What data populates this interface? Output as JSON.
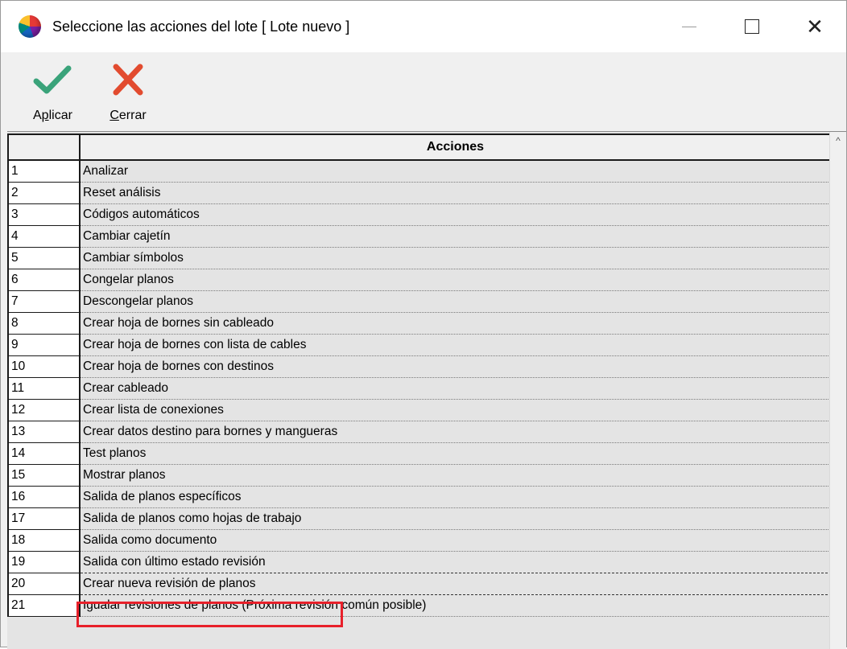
{
  "window": {
    "title": "Seleccione las acciones del lote [ Lote nuevo ]",
    "controls": {
      "minimize": "—",
      "maximize": "☐",
      "close": "✕"
    }
  },
  "toolbar": {
    "apply": {
      "label_pre": "A",
      "label_underlined": "p",
      "label_post": "licar",
      "icon": "check-icon",
      "color": "#3aa37a"
    },
    "close": {
      "label_pre": "",
      "label_underlined": "C",
      "label_post": "errar",
      "icon": "close-x-icon",
      "color": "#e24b2f"
    }
  },
  "grid": {
    "header": {
      "corner": "",
      "actions": "Acciones"
    },
    "selected_row": 20,
    "highlight_color": "#e8202a",
    "rows": [
      {
        "num": "1",
        "action": "Analizar"
      },
      {
        "num": "2",
        "action": "Reset análisis"
      },
      {
        "num": "3",
        "action": "Códigos automáticos"
      },
      {
        "num": "4",
        "action": "Cambiar cajetín"
      },
      {
        "num": "5",
        "action": "Cambiar símbolos"
      },
      {
        "num": "6",
        "action": "Congelar planos"
      },
      {
        "num": "7",
        "action": "Descongelar planos"
      },
      {
        "num": "8",
        "action": "Crear hoja de bornes sin cableado"
      },
      {
        "num": "9",
        "action": "Crear hoja de bornes con lista de cables"
      },
      {
        "num": "10",
        "action": "Crear hoja de bornes con destinos"
      },
      {
        "num": "11",
        "action": "Crear cableado"
      },
      {
        "num": "12",
        "action": "Crear lista de conexiones"
      },
      {
        "num": "13",
        "action": "Crear datos destino para bornes y mangueras"
      },
      {
        "num": "14",
        "action": "Test planos"
      },
      {
        "num": "15",
        "action": "Mostrar planos"
      },
      {
        "num": "16",
        "action": "Salida de planos específicos"
      },
      {
        "num": "17",
        "action": "Salida de planos como hojas de trabajo"
      },
      {
        "num": "18",
        "action": "Salida como documento"
      },
      {
        "num": "19",
        "action": "Salida con último estado revisión"
      },
      {
        "num": "20",
        "action": "Crear nueva revisión de planos"
      },
      {
        "num": "21",
        "action": "Igualar revisiones de planos (Próxima revisión común posible)"
      }
    ]
  }
}
